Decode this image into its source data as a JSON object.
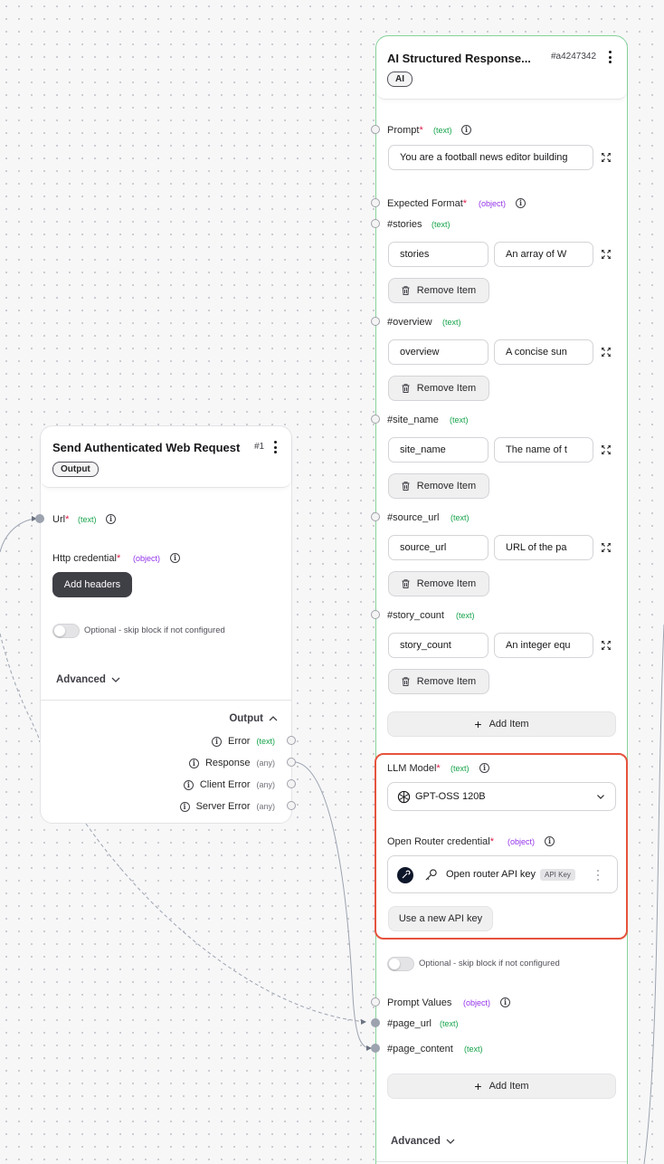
{
  "left_node": {
    "title": "Send Authenticated Web Request",
    "id": "#1",
    "badge": "Output",
    "url_label": "Url",
    "url_type": "(text)",
    "credential_label": "Http credential",
    "credential_type": "(object)",
    "add_headers": "Add headers",
    "optional_label": "Optional - skip block if not configured",
    "advanced": "Advanced",
    "output_header": "Output",
    "outputs": [
      {
        "label": "Error",
        "type": "(text)"
      },
      {
        "label": "Response",
        "type": "(any)"
      },
      {
        "label": "Client Error",
        "type": "(any)"
      },
      {
        "label": "Server Error",
        "type": "(any)"
      }
    ]
  },
  "right_node": {
    "title": "AI Structured Response...",
    "id": "#a4247342",
    "badge": "AI",
    "prompt_label": "Prompt",
    "prompt_type": "(text)",
    "prompt_value": "You are a football news editor building",
    "expected_format_label": "Expected Format",
    "expected_format_type": "(object)",
    "format_items": [
      {
        "key_label": "#stories",
        "type": "(text)",
        "key": "stories",
        "value": "An array of W"
      },
      {
        "key_label": "#overview",
        "type": "(text)",
        "key": "overview",
        "value": "A concise sun"
      },
      {
        "key_label": "#site_name",
        "type": "(text)",
        "key": "site_name",
        "value": "The name of t"
      },
      {
        "key_label": "#source_url",
        "type": "(text)",
        "key": "source_url",
        "value": "URL of the pa"
      },
      {
        "key_label": "#story_count",
        "type": "(text)",
        "key": "story_count",
        "value": "An integer equ"
      }
    ],
    "remove_item": "Remove Item",
    "add_item": "Add Item",
    "llm_label": "LLM Model",
    "llm_type": "(text)",
    "llm_value": "GPT-OSS 120B",
    "cred_label": "Open Router credential",
    "cred_type": "(object)",
    "cred_value": "Open router API key",
    "cred_badge": "API Key",
    "use_new_key": "Use a new API key",
    "optional_label": "Optional - skip block if not configured",
    "prompt_values_label": "Prompt Values",
    "prompt_values_type": "(object)",
    "prompt_value_items": [
      {
        "label": "#page_url",
        "type": "(text)"
      },
      {
        "label": "#page_content",
        "type": "(text)"
      }
    ],
    "add_item_2": "Add Item",
    "advanced": "Advanced"
  },
  "colors": {
    "highlight": "#e5533d",
    "selected_border": "#86d39a",
    "text_type": "#16a34a",
    "object_type": "#9333ea"
  }
}
